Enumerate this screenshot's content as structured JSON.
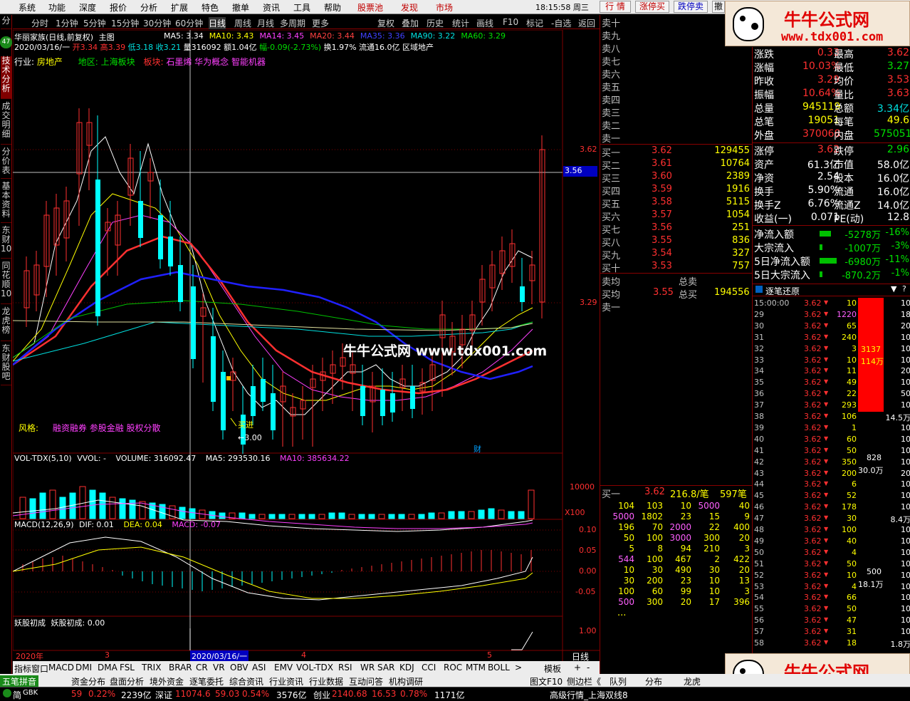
{
  "menu": {
    "items": [
      "系统",
      "功能",
      "深度",
      "报价",
      "分析",
      "扩展",
      "特色",
      "撤单",
      "资讯",
      "工具",
      "帮助"
    ],
    "gupiaochi": "股票池",
    "faxian": "发现",
    "shichang": "市场",
    "clock": "18:15:58 周三",
    "buttons": [
      "行 情",
      "涨停买",
      "跌停卖",
      "撤"
    ]
  },
  "ad": {
    "title": "牛牛公式网",
    "url": "www.tdx001.com",
    "watermark": "牛牛公式网 www.tdx001.com"
  },
  "periods": [
    "分时",
    "1分钟",
    "5分钟",
    "15分钟",
    "30分钟",
    "60分钟",
    "日线",
    "周线",
    "月线",
    "多周期",
    "更多"
  ],
  "period_active": "日线",
  "toolbar": [
    "复权",
    "叠加",
    "历史",
    "统计",
    "画线",
    "F10",
    "标记",
    "-自选",
    "返回"
  ],
  "left_tabs": [
    "分",
    "技术分析",
    "成交明细",
    "分价表",
    "基本资料",
    "东财10",
    "同花顺10",
    "龙虎榜",
    "东财股吧"
  ],
  "left_badge": "47",
  "info": {
    "stock": "华丽家族(日线,前复权)",
    "zhutu": "主图",
    "ma": [
      {
        "label": "MA5: 3.34",
        "color": "#ffffff"
      },
      {
        "label": "MA10: 3.43",
        "color": "#ffff00"
      },
      {
        "label": "MA14: 3.45",
        "color": "#ff40ff"
      },
      {
        "label": "MA20: 3.44",
        "color": "#ff4040"
      },
      {
        "label": "MA35: 3.36",
        "color": "#4040ff"
      },
      {
        "label": "MA90: 3.22",
        "color": "#00e0e0"
      },
      {
        "label": "MA60: 3.29",
        "color": "#00e000"
      }
    ],
    "line2_date": "2020/03/16/一",
    "line2_open": "开3.34",
    "line2_high": "高3.39",
    "line2_low": "低3.18",
    "line2_close": "收3.21",
    "line2_vol": "量316092",
    "line2_amt": "额1.04亿",
    "line2_chg": "幅-0.09(-2.73%)",
    "line2_rest": "换1.97% 流通16.0亿 区域地产",
    "industry_label": "行业:",
    "industry": "房地产",
    "region": "地区:",
    "region_val": "上海板块",
    "sector_label": "板块:",
    "sector": "石墨烯 华为概念 智能机器",
    "style_label": "风格:",
    "style": "融资融券 参股金融 股权分散",
    "annot_buy": "买进",
    "annot_low": "←3.00",
    "annot_cai": "财"
  },
  "price_axis": {
    "p1": "3.62",
    "p2": "3.56",
    "p3": "3.29"
  },
  "vol": {
    "title": "VOL-TDX(5,10)",
    "vvol": "VVOL: -",
    "volume": "VOLUME: 316092.47",
    "ma5": "MA5: 293530.16",
    "ma10": "MA10: 385634.22",
    "axis": "10000",
    "x100": "X100"
  },
  "macd": {
    "title": "MACD(12,26,9)",
    "dif": "DIF: 0.01",
    "dea": "DEA: 0.04",
    "macd": "MACD: -0.07",
    "axis": [
      "0.10",
      "0.05",
      "0.00",
      "-0.05"
    ]
  },
  "yao": {
    "title": "妖股初成",
    "line": "妖股初成: 0.00",
    "axis": "1.00"
  },
  "date_axis": {
    "year": "2020年",
    "m3": "3",
    "cursor": "2020/03/16/一",
    "m4": "4",
    "m5": "5",
    "period": "日线"
  },
  "sell": [
    "卖十",
    "卖九",
    "卖八",
    "卖七",
    "卖六",
    "卖五",
    "卖四",
    "卖三",
    "卖二",
    "卖一"
  ],
  "buy": [
    {
      "label": "买一",
      "price": "3.62",
      "vol": "129455"
    },
    {
      "label": "买二",
      "price": "3.61",
      "vol": "10764"
    },
    {
      "label": "买三",
      "price": "3.60",
      "vol": "2389"
    },
    {
      "label": "买四",
      "price": "3.59",
      "vol": "1916"
    },
    {
      "label": "买五",
      "price": "3.58",
      "vol": "5115"
    },
    {
      "label": "买六",
      "price": "3.57",
      "vol": "1054"
    },
    {
      "label": "买七",
      "price": "3.56",
      "vol": "251"
    },
    {
      "label": "买八",
      "price": "3.55",
      "vol": "836"
    },
    {
      "label": "买九",
      "price": "3.54",
      "vol": "327"
    },
    {
      "label": "买十",
      "price": "3.53",
      "vol": "757"
    }
  ],
  "avg": {
    "maijun": "卖均",
    "zongmai": "总卖",
    "mairjun": "买均",
    "mairjun_price": "3.55",
    "zongmair": "总买",
    "zongmair_vol": "194556",
    "mai1": "卖一"
  },
  "queue": {
    "head_label": "买一",
    "head_price": "3.62",
    "head_val": "216.8/笔",
    "head_cnt": "597笔",
    "rows": [
      [
        "104",
        "103",
        "10",
        "5000",
        "40"
      ],
      [
        "5000",
        "1802",
        "23",
        "15",
        "9"
      ],
      [
        "196",
        "70",
        "2000",
        "22",
        "400"
      ],
      [
        "50",
        "100",
        "3000",
        "300",
        "20"
      ],
      [
        "5",
        "8",
        "94",
        "210",
        "3"
      ],
      [
        "544",
        "100",
        "467",
        "2",
        "422"
      ],
      [
        "10",
        "30",
        "490",
        "30",
        "20"
      ],
      [
        "30",
        "200",
        "23",
        "10",
        "13"
      ],
      [
        "100",
        "60",
        "99",
        "10",
        "3"
      ],
      [
        "500",
        "300",
        "20",
        "17",
        "396"
      ]
    ],
    "more": "..."
  },
  "stats": [
    {
      "l": "涨跌",
      "v": "0.33",
      "l2": "最高",
      "v2": "3.62"
    },
    {
      "l": "涨幅",
      "v": "10.03%",
      "l2": "最低",
      "v2": "3.27"
    },
    {
      "l": "昨收",
      "v": "3.29",
      "l2": "均价",
      "v2": "3.53"
    },
    {
      "l": "振幅",
      "v": "10.64%",
      "l2": "量比",
      "v2": "3.63"
    },
    {
      "l": "总量",
      "v": "945119",
      "l2": "总额",
      "v2": "3.34亿"
    },
    {
      "l": "总笔",
      "v": "19051",
      "l2": "每笔",
      "v2": "49.6"
    },
    {
      "l": "外盘",
      "v": "370068",
      "l2": "内盘",
      "v2": "575051"
    }
  ],
  "stats2": [
    {
      "l": "涨停",
      "v": "3.62",
      "l2": "跌停",
      "v2": "2.96"
    },
    {
      "l": "资产",
      "v": "61.3亿",
      "l2": "市值",
      "v2": "58.0亿"
    },
    {
      "l": "净资",
      "v": "2.54",
      "l2": "股本",
      "v2": "16.0亿"
    },
    {
      "l": "换手",
      "v": "5.90%",
      "l2": "流通",
      "v2": "16.0亿"
    },
    {
      "l": "换手Z",
      "v": "6.76%",
      "l2": "流通Z",
      "v2": "14.0亿"
    },
    {
      "l": "收益(一)",
      "v": "0.071",
      "l2": "PE(动)",
      "v2": "12.8"
    }
  ],
  "flows": [
    {
      "l": "净流入额",
      "v": "-5278万",
      "p": "-16%"
    },
    {
      "l": "大宗流入",
      "v": "-1007万",
      "p": "-3%"
    },
    {
      "l": "5日净流入额",
      "v": "-6980万",
      "p": "-11%"
    },
    {
      "l": "5日大宗流入",
      "v": "-870.2万",
      "p": "-1%"
    }
  ],
  "ticks": {
    "title": "逐笔还原",
    "rows": [
      [
        "15:00:00",
        "3.62",
        "10"
      ],
      [
        "29",
        "3.62",
        "1220"
      ],
      [
        "30",
        "3.62",
        "65"
      ],
      [
        "31",
        "3.62",
        "240"
      ],
      [
        "32",
        "3.62",
        "3"
      ],
      [
        "33",
        "3.62",
        "10"
      ],
      [
        "34",
        "3.62",
        "11"
      ],
      [
        "35",
        "3.62",
        "49"
      ],
      [
        "36",
        "3.62",
        "22"
      ],
      [
        "37",
        "3.62",
        "293"
      ],
      [
        "38",
        "3.62",
        "106"
      ],
      [
        "39",
        "3.62",
        "1"
      ],
      [
        "40",
        "3.62",
        "60"
      ],
      [
        "41",
        "3.62",
        "50"
      ],
      [
        "42",
        "3.62",
        "350"
      ],
      [
        "43",
        "3.62",
        "200"
      ],
      [
        "44",
        "3.62",
        "6"
      ],
      [
        "45",
        "3.62",
        "52"
      ],
      [
        "46",
        "3.62",
        "178"
      ],
      [
        "47",
        "3.62",
        "30"
      ],
      [
        "48",
        "3.62",
        "100"
      ],
      [
        "49",
        "3.62",
        "40"
      ],
      [
        "50",
        "3.62",
        "4"
      ],
      [
        "51",
        "3.62",
        "50"
      ],
      [
        "52",
        "3.62",
        "10"
      ],
      [
        "53",
        "3.62",
        "4"
      ],
      [
        "54",
        "3.62",
        "66"
      ],
      [
        "55",
        "3.62",
        "50"
      ],
      [
        "56",
        "3.62",
        "47"
      ],
      [
        "57",
        "3.62",
        "31"
      ],
      [
        "58",
        "3.62",
        "18"
      ]
    ],
    "right_col": [
      "10",
      "18",
      "20",
      "10",
      "10",
      "10",
      "20",
      "10",
      "50",
      "10",
      "14.5万",
      "10",
      "10",
      "10",
      "10",
      "20",
      "10",
      "10",
      "10",
      "8.4万",
      "10",
      "10",
      "10",
      "10",
      "10",
      "10",
      "10",
      "10",
      "10",
      "10",
      "1.8万"
    ],
    "bar1_a": "3137",
    "bar1_b": "114万",
    "bar2_a": "828",
    "bar2_b": "30.0万",
    "bar3_a": "500",
    "bar3_b": "18.1万"
  },
  "indicator_tabs": [
    "指标",
    "窗口",
    "MACD",
    "DMI",
    "DMA",
    "FSL",
    "TRIX",
    "BRAR",
    "CR",
    "VR",
    "OBV",
    "ASI",
    "EMV",
    "VOL-TDX",
    "RSI",
    "WR",
    "SAR",
    "KDJ",
    "CCI",
    "ROC",
    "MTM",
    "BOLL",
    ">",
    "模板",
    "+",
    "-"
  ],
  "bottom_tabs": [
    "五笔拼音",
    "资金分布",
    "盘面分析",
    "境外资金",
    "逐笔委托",
    "综合资讯",
    "行业资讯",
    "行业数据",
    "互动问答",
    "机构调研",
    "图文F10",
    "侧边栏《",
    "队列",
    "分布",
    "龙虎"
  ],
  "status": {
    "first": "简",
    "sh1": "59",
    "sh2": "0.22%",
    "sh3": "2239亿",
    "sz_label": "深证",
    "sz1": "11074.6",
    "sz2": "59.03",
    "sz3": "0.54%",
    "sz4": "3576亿",
    "cy_label": "创业",
    "cy1": "2140.68",
    "cy2": "16.53",
    "cy3": "0.78%",
    "cy4": "1171亿",
    "right": "高级行情_上海双线8"
  },
  "colors": {
    "up": "#ff3030",
    "down": "#00ffff",
    "bg": "#000000",
    "frame": "#800000"
  }
}
